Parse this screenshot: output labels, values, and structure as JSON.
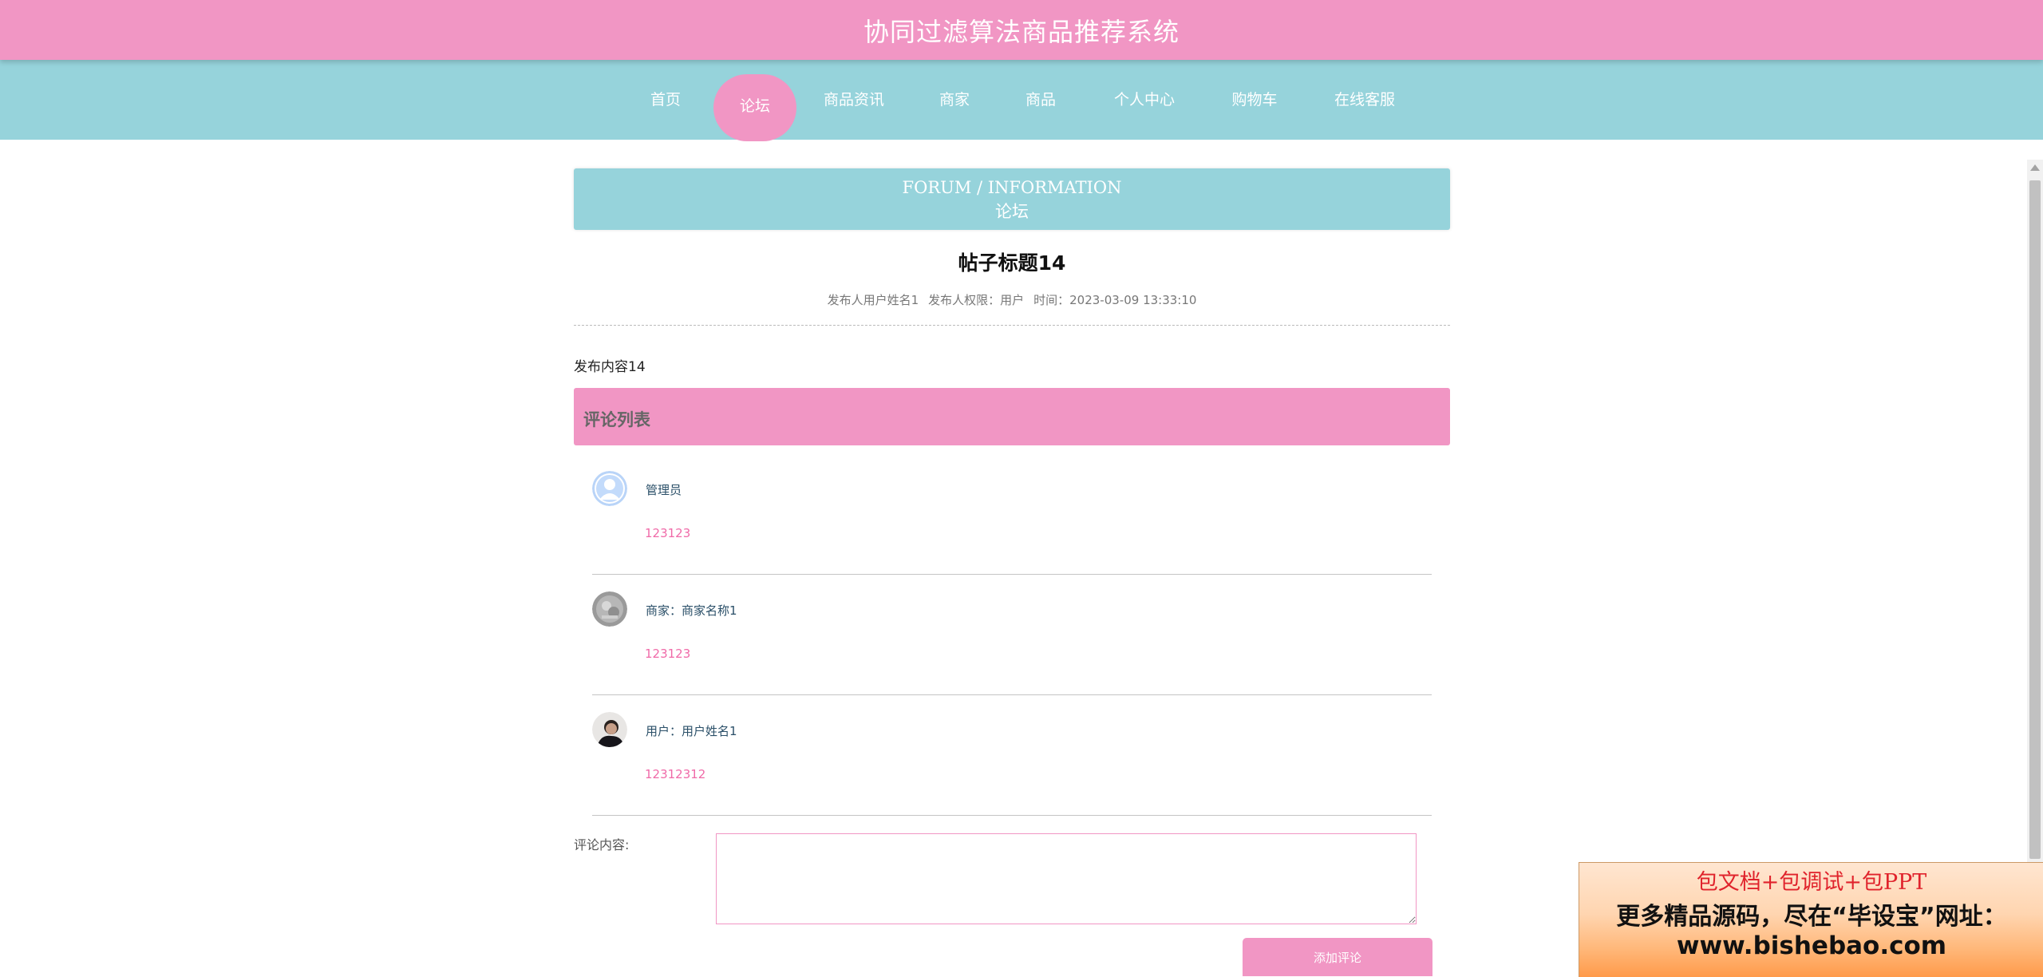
{
  "header": {
    "title": "协同过滤算法商品推荐系统"
  },
  "nav": {
    "items": [
      {
        "label": "首页",
        "active": false
      },
      {
        "label": "论坛",
        "active": true
      },
      {
        "label": "商品资讯",
        "active": false
      },
      {
        "label": "商家",
        "active": false
      },
      {
        "label": "商品",
        "active": false
      },
      {
        "label": "个人中心",
        "active": false
      },
      {
        "label": "购物车",
        "active": false
      },
      {
        "label": "在线客服",
        "active": false
      }
    ]
  },
  "banner": {
    "en": "FORUM / INFORMATION",
    "cn": "论坛"
  },
  "post": {
    "title": "帖子标题14",
    "author": "发布人用户姓名1",
    "role": "发布人权限：用户",
    "time": "时间：2023-03-09 13:33:10",
    "content": "发布内容14"
  },
  "comments": {
    "heading": "评论列表",
    "items": [
      {
        "name": "管理员",
        "text": "123123",
        "avatar": "default-user-icon"
      },
      {
        "name": "商家：商家名称1",
        "text": "123123",
        "avatar": "shop-avatar"
      },
      {
        "name": "用户：用户姓名1",
        "text": "12312312",
        "avatar": "user-photo-avatar"
      }
    ]
  },
  "form": {
    "label": "评论内容:",
    "textarea_value": "",
    "submit_label": "添加评论"
  },
  "ad": {
    "line1": "包文档+包调试+包PPT",
    "line2": "更多精品源码，尽在“毕设宝”网址：",
    "line3": "www.bishebao.com"
  },
  "colors": {
    "pink": "#f196c4",
    "teal": "#96d3db",
    "link": "#f06aa8"
  }
}
